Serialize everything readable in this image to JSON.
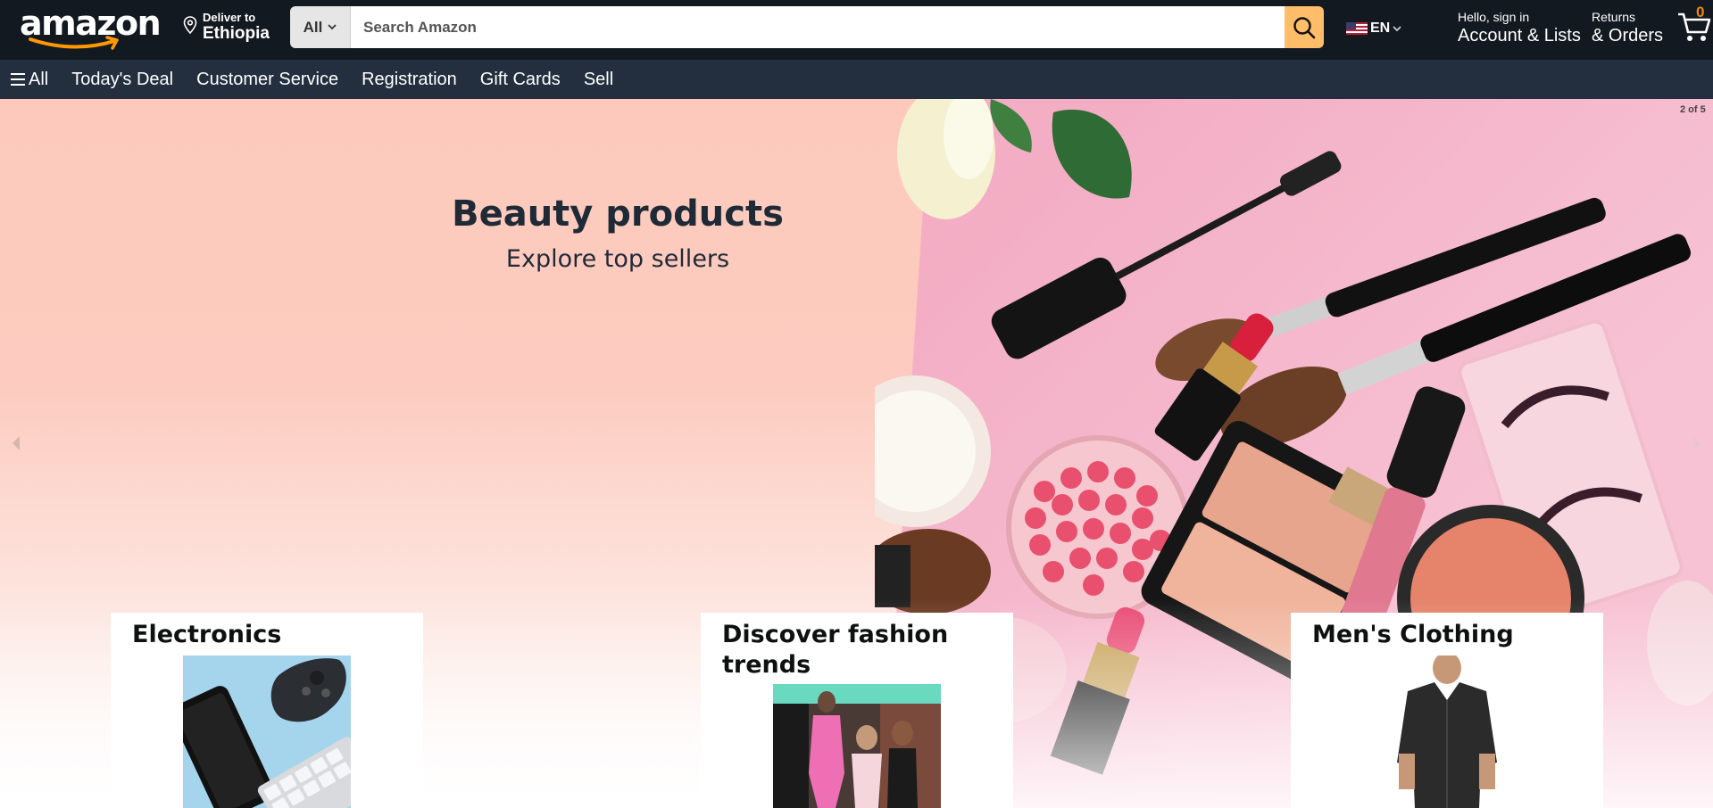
{
  "header": {
    "logo_text": "amazon",
    "deliver_label": "Deliver to",
    "deliver_location": "Ethiopia",
    "search_category": "All",
    "search_placeholder": "Search Amazon",
    "language": "EN",
    "account_line1": "Hello, sign in",
    "account_line2": "Account & Lists",
    "orders_line1": "Returns",
    "orders_line2": "& Orders",
    "cart_count": "0"
  },
  "subnav": {
    "all_label": "All",
    "items": [
      "Today's Deal",
      "Customer Service",
      "Registration",
      "Gift Cards",
      "Sell"
    ]
  },
  "hero": {
    "title": "Beauty products",
    "subtitle": "Explore top sellers",
    "slide_indicator": "2 of 5"
  },
  "cards": [
    {
      "title": "Electronics"
    },
    {
      "title": "Discover fashion trends"
    },
    {
      "title": "Men's Clothing"
    }
  ]
}
